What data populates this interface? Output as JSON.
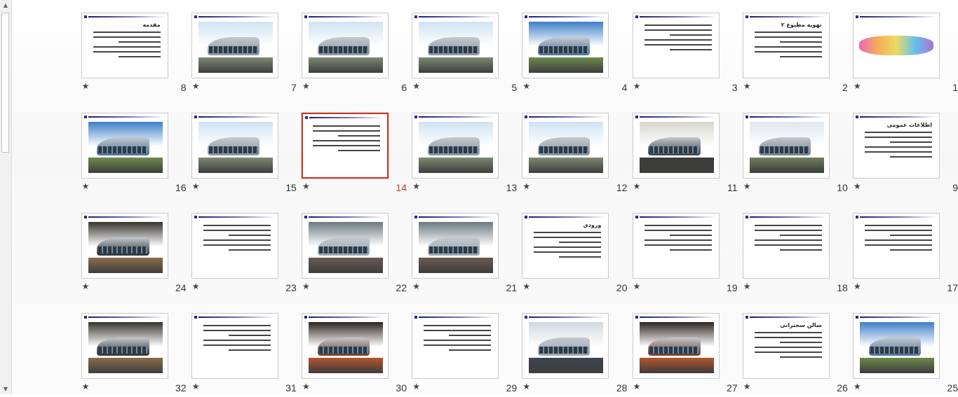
{
  "scrollbar": {
    "up_icon": "up-arrow-icon",
    "down_icon": "down-arrow-icon"
  },
  "selected_slide": "14",
  "slides": [
    {
      "n": "1",
      "kind": "title"
    },
    {
      "n": "2",
      "kind": "text",
      "title": "تهویه مطبوع ۲"
    },
    {
      "n": "3",
      "kind": "text",
      "title": ""
    },
    {
      "n": "4",
      "kind": "photo",
      "theme": "glass"
    },
    {
      "n": "5",
      "kind": "photo",
      "theme": "street"
    },
    {
      "n": "6",
      "kind": "photo",
      "theme": "street"
    },
    {
      "n": "7",
      "kind": "photo",
      "theme": "street"
    },
    {
      "n": "8",
      "kind": "text",
      "title": "مقدمه"
    },
    {
      "n": "9",
      "kind": "text",
      "title": "اطلاعات عمومی"
    },
    {
      "n": "10",
      "kind": "photo",
      "theme": "trees"
    },
    {
      "n": "11",
      "kind": "photo",
      "theme": "dusk"
    },
    {
      "n": "12",
      "kind": "photo",
      "theme": "street"
    },
    {
      "n": "13",
      "kind": "photo",
      "theme": "street"
    },
    {
      "n": "14",
      "kind": "text",
      "title": ""
    },
    {
      "n": "15",
      "kind": "photo",
      "theme": "street"
    },
    {
      "n": "16",
      "kind": "photo",
      "theme": "glass"
    },
    {
      "n": "17",
      "kind": "text",
      "title": ""
    },
    {
      "n": "18",
      "kind": "text",
      "title": ""
    },
    {
      "n": "19",
      "kind": "text",
      "title": ""
    },
    {
      "n": "20",
      "kind": "text",
      "title": "ورودی"
    },
    {
      "n": "21",
      "kind": "photo",
      "theme": "interior"
    },
    {
      "n": "22",
      "kind": "photo",
      "theme": "interior"
    },
    {
      "n": "23",
      "kind": "text",
      "title": ""
    },
    {
      "n": "24",
      "kind": "photo",
      "theme": "corridor"
    },
    {
      "n": "25",
      "kind": "photo",
      "theme": "glass"
    },
    {
      "n": "26",
      "kind": "text",
      "title": "سالن سخنرانی"
    },
    {
      "n": "27",
      "kind": "photo",
      "theme": "hall"
    },
    {
      "n": "28",
      "kind": "photo",
      "theme": "hallblue"
    },
    {
      "n": "29",
      "kind": "text",
      "title": ""
    },
    {
      "n": "30",
      "kind": "photo",
      "theme": "hall"
    },
    {
      "n": "31",
      "kind": "text",
      "title": ""
    },
    {
      "n": "32",
      "kind": "photo",
      "theme": "corridor"
    }
  ]
}
